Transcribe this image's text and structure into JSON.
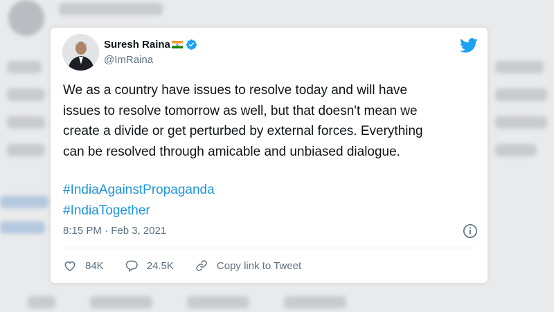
{
  "tweet": {
    "author_name": "Suresh Raina",
    "author_handle": "@ImRaina",
    "text": "We as a country have issues to resolve today and will have\nissues to resolve tomorrow as well, but that doesn't mean we\ncreate a divide or get perturbed by external forces. Everything\ncan be resolved through amicable and unbiased dialogue.",
    "hashtags": [
      "#IndiaAgainstPropaganda",
      "#IndiaTogether"
    ],
    "timestamp": "8:15 PM · Feb 3, 2021"
  },
  "actions": {
    "likes": "84K",
    "replies": "24.5K",
    "copy_link_label": "Copy link to Tweet"
  },
  "colors": {
    "text": "#0f1419",
    "secondary": "#5b7083",
    "link": "#1b95e0",
    "twitter_blue": "#1da1f2"
  },
  "icons": [
    "twitter-bird-icon",
    "verified-badge-icon",
    "india-flag-icon",
    "info-icon",
    "heart-icon",
    "reply-icon",
    "link-icon"
  ]
}
